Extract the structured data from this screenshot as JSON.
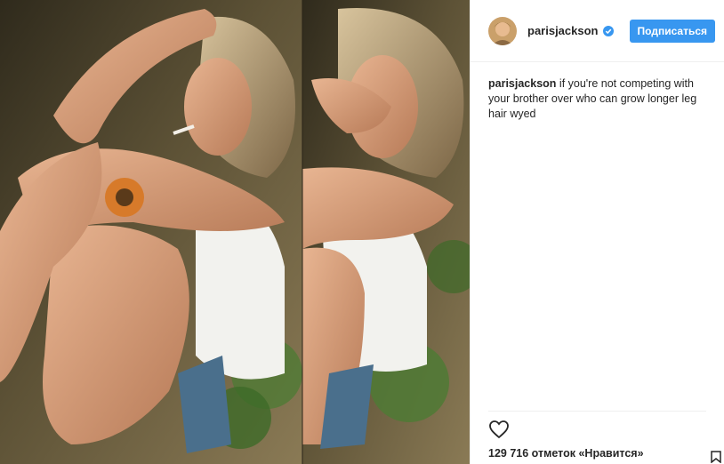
{
  "post": {
    "username": "parisjackson",
    "follow_label": "Подписаться",
    "caption_user": "parisjackson",
    "caption_text": " if you're not competing with your brother over who can grow longer leg hair wyed",
    "likes_text": "129 716 отметок «Нравится»"
  },
  "colors": {
    "accent": "#3897f0",
    "text": "#262626",
    "border": "#efefef"
  },
  "icons": {
    "verified": "verified-badge-icon",
    "like": "heart-outline-icon"
  }
}
